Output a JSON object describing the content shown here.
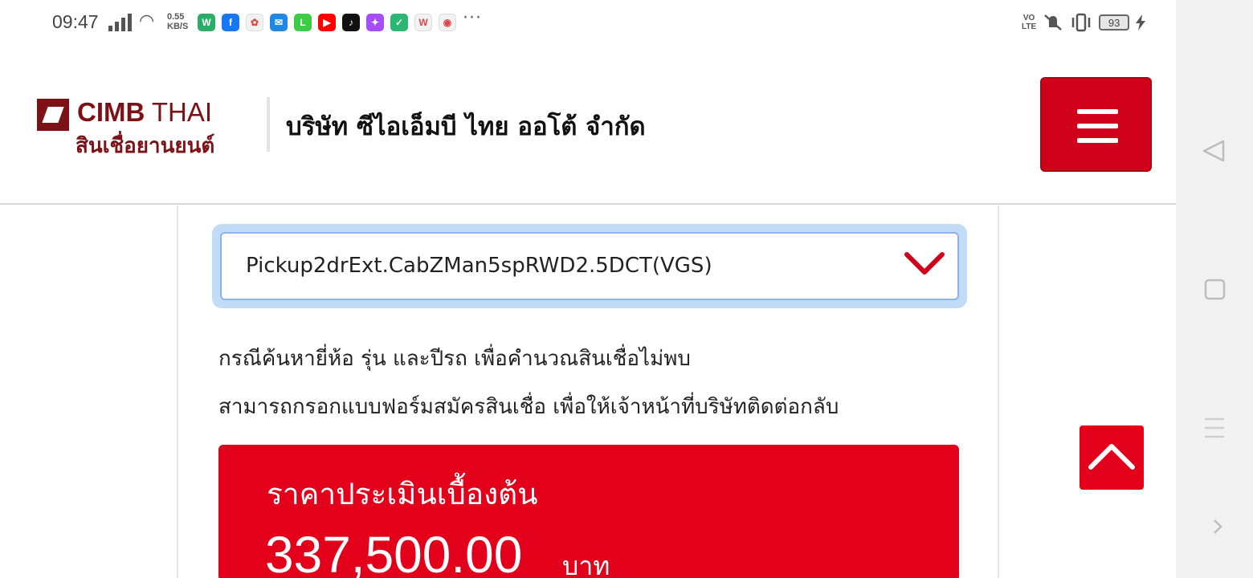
{
  "status_bar": {
    "time": "09:47",
    "net_speed_value": "0.55",
    "net_speed_unit": "KB/S",
    "app_icons": [
      {
        "name": "wechat-icon",
        "color": "#2aae67",
        "glyph": "W"
      },
      {
        "name": "facebook-icon",
        "color": "#1877f2",
        "glyph": "f"
      },
      {
        "name": "photos-icon",
        "color": "#f2f2f2",
        "glyph": "✿"
      },
      {
        "name": "messenger-lite-icon",
        "color": "#1e88e5",
        "glyph": "✉"
      },
      {
        "name": "line-icon",
        "color": "#3acd45",
        "glyph": "L"
      },
      {
        "name": "youtube-icon",
        "color": "#ff0000",
        "glyph": "▶"
      },
      {
        "name": "tiktok-icon",
        "color": "#111111",
        "glyph": "♪"
      },
      {
        "name": "messenger-icon",
        "color": "#a64dff",
        "glyph": "✦"
      },
      {
        "name": "shield-app-icon",
        "color": "#2bb673",
        "glyph": "✓"
      },
      {
        "name": "wps-icon",
        "color": "#f2f2f2",
        "glyph": "W"
      },
      {
        "name": "chrome-icon",
        "color": "#f2f2f2",
        "glyph": "◉"
      }
    ],
    "more": "···",
    "volte_top": "VO",
    "volte_bottom": "LTE",
    "battery": "93"
  },
  "header": {
    "logo_word_bold": "CIMB",
    "logo_word_light": " THAI",
    "logo_sub": "สินเชื่อยานยนต์",
    "company_name": "บริษัท ซีไอเอ็มบี ไทย ออโต้ จำกัด"
  },
  "model_select": {
    "value": "Pickup2drExt.CabZMan5spRWD2.5DCT(VGS)"
  },
  "notes": {
    "line1": "กรณีค้นหายี่ห้อ รุ่น และปีรถ เพื่อคำนวณสินเชื่อไม่พบ",
    "line2": "สามารถกรอกแบบฟอร์มสมัครสินเชื่อ เพื่อให้เจ้าหน้าที่บริษัทติดต่อกลับ"
  },
  "price": {
    "label": "ราคาประเมินเบื้องต้น",
    "value": "337,500.00",
    "unit": "บาท"
  },
  "colors": {
    "brand_red": "#e3001b",
    "logo_maroon": "#7d1216",
    "focus_ring": "#c2dbf7"
  }
}
